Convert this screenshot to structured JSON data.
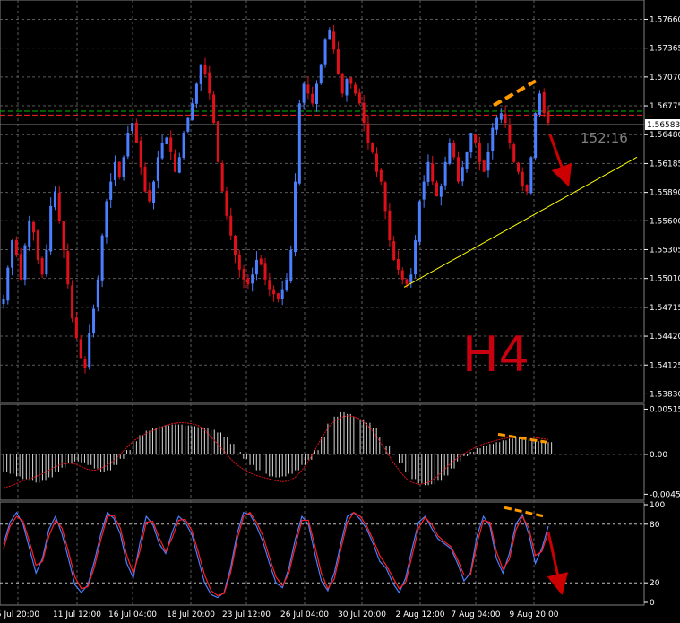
{
  "chart_data": [
    {
      "type": "candlestick",
      "panel": "main",
      "timeframe_label": "H4",
      "countdown": "152:16",
      "current_price": "1.56583",
      "y_ticks": [
        "1.57660",
        "1.57365",
        "1.57070",
        "1.56775",
        "1.56480",
        "1.56185",
        "1.55890",
        "1.55600",
        "1.55305",
        "1.55010",
        "1.54715",
        "1.54420",
        "1.54125",
        "1.53830"
      ],
      "ylim": [
        1.5377,
        1.5782
      ],
      "price_lines": [
        {
          "value": 1.5672,
          "color": "#00c000",
          "style": "dashed"
        },
        {
          "value": 1.5668,
          "color": "#ff2020",
          "style": "dashed"
        },
        {
          "value": 1.56583,
          "color": "#808080",
          "style": "solid"
        }
      ],
      "trendline": {
        "from": [
          "2 Aug 12:00",
          1.5492
        ],
        "to": [
          "9 Aug 20:00+",
          1.5644
        ],
        "color": "#ffff00"
      },
      "annotations": [
        {
          "type": "dashed-line",
          "color": "#ff9900",
          "from": [
            "7 Aug 04:00+",
            1.5678
          ],
          "to": [
            "9 Aug 20:00",
            1.5703
          ]
        },
        {
          "type": "arrow",
          "color": "#cc0000",
          "from": [
            "9 Aug 20:00+",
            1.5648
          ],
          "to": [
            "9 Aug 20:00++",
            1.5605
          ]
        }
      ],
      "close_path": [
        1.548,
        1.5512,
        1.554,
        1.5525,
        1.55,
        1.5535,
        1.556,
        1.5548,
        1.552,
        1.5505,
        1.553,
        1.5575,
        1.559,
        1.556,
        1.553,
        1.5495,
        1.546,
        1.544,
        1.542,
        1.541,
        1.5445,
        1.547,
        1.55,
        1.5545,
        1.558,
        1.56,
        1.562,
        1.5605,
        1.5625,
        1.565,
        1.566,
        1.564,
        1.5615,
        1.559,
        1.558,
        1.56,
        1.5625,
        1.564,
        1.5645,
        1.563,
        1.561,
        1.5625,
        1.565,
        1.5665,
        1.568,
        1.57,
        1.572,
        1.571,
        1.569,
        1.566,
        1.562,
        1.559,
        1.5565,
        1.5545,
        1.5525,
        1.551,
        1.55,
        1.5495,
        1.5505,
        1.552,
        1.5515,
        1.55,
        1.549,
        1.5485,
        1.548,
        1.549,
        1.55,
        1.553,
        1.56,
        1.568,
        1.57,
        1.569,
        1.568,
        1.57,
        1.572,
        1.5745,
        1.5755,
        1.5735,
        1.571,
        1.569,
        1.5705,
        1.57,
        1.569,
        1.568,
        1.566,
        1.564,
        1.563,
        1.561,
        1.56,
        1.557,
        1.554,
        1.552,
        1.551,
        1.55,
        1.5495,
        1.5505,
        1.554,
        1.558,
        1.56,
        1.562,
        1.56,
        1.5585,
        1.5595,
        1.562,
        1.564,
        1.5625,
        1.56,
        1.5615,
        1.563,
        1.565,
        1.564,
        1.562,
        1.561,
        1.563,
        1.5655,
        1.5665,
        1.567,
        1.566,
        1.564,
        1.562,
        1.561,
        1.5595,
        1.559,
        1.5625,
        1.567,
        1.569,
        1.567,
        1.566
      ]
    },
    {
      "type": "histogram",
      "panel": "oscillator",
      "y_ticks": [
        "0.00515",
        "0.00",
        "-0.00453"
      ],
      "ylim": [
        -0.0049,
        0.0054
      ],
      "annotations": [
        {
          "type": "dashed-line",
          "color": "#ff9900",
          "from": [
            "7 Aug 04:00+",
            0.0023
          ],
          "to": [
            "9 Aug 20:00",
            0.0014
          ]
        }
      ],
      "histogram_path": [
        -0.002,
        -0.0022,
        -0.0025,
        -0.0028,
        -0.003,
        -0.0032,
        -0.003,
        -0.0026,
        -0.002,
        -0.0015,
        -0.001,
        -0.0008,
        -0.0009,
        -0.0012,
        -0.0016,
        -0.002,
        -0.0018,
        -0.0012,
        -0.0005,
        0.0005,
        0.0015,
        0.0022,
        0.0027,
        0.003,
        0.0032,
        0.0033,
        0.0034,
        0.0034,
        0.0033,
        0.0032,
        0.0031,
        0.003,
        0.0028,
        0.0025,
        0.002,
        0.0012,
        0.0003,
        -0.0005,
        -0.0012,
        -0.0018,
        -0.0022,
        -0.0025,
        -0.0026,
        -0.0025,
        -0.0022,
        -0.0018,
        -0.0012,
        -0.0006,
        0.0005,
        0.002,
        0.0035,
        0.0043,
        0.0048,
        0.0046,
        0.0043,
        0.004,
        0.0036,
        0.003,
        0.002,
        0.001,
        0.0,
        -0.001,
        -0.002,
        -0.0028,
        -0.0033,
        -0.0035,
        -0.0034,
        -0.003,
        -0.0024,
        -0.0016,
        -0.0008,
        -0.0002,
        0.0003,
        0.0007,
        0.001,
        0.0012,
        0.0014,
        0.0016,
        0.0018,
        0.002,
        0.0019,
        0.0017,
        0.0015,
        0.0014,
        0.0014
      ],
      "signal_path": [
        -0.0038,
        -0.0036,
        -0.0033,
        -0.003,
        -0.0028,
        -0.0025,
        -0.0022,
        -0.0018,
        -0.0014,
        -0.0011,
        -0.001,
        -0.0011,
        -0.0014,
        -0.0017,
        -0.0018,
        -0.0016,
        -0.0012,
        -0.0007,
        0.0,
        0.0008,
        0.0015,
        0.002,
        0.0024,
        0.0027,
        0.003,
        0.0033,
        0.0035,
        0.0036,
        0.0036,
        0.0035,
        0.0033,
        0.0028,
        0.002,
        0.0012,
        0.0004,
        -0.0005,
        -0.0012,
        -0.0017,
        -0.0021,
        -0.0024,
        -0.0026,
        -0.0028,
        -0.003,
        -0.0031,
        -0.003,
        -0.0026,
        -0.0018,
        -0.0008,
        0.0005,
        0.0018,
        0.003,
        0.0038,
        0.0042,
        0.0044,
        0.0043,
        0.004,
        0.0034,
        0.0026,
        0.0015,
        0.0004,
        -0.0008,
        -0.0018,
        -0.0027,
        -0.0032,
        -0.0034,
        -0.0033,
        -0.003,
        -0.0024,
        -0.0017,
        -0.001,
        -0.0004,
        0.0001,
        0.0005,
        0.0009,
        0.0012,
        0.0014,
        0.0016,
        0.0018,
        0.0019,
        0.002,
        0.002,
        0.002,
        0.0019,
        0.0018,
        0.0017
      ]
    },
    {
      "type": "line",
      "panel": "stochastic",
      "y_ticks": [
        "100",
        "80",
        "20",
        "0"
      ],
      "ylim": [
        0,
        100
      ],
      "levels": [
        80,
        20
      ],
      "annotations": [
        {
          "type": "dashed-line",
          "color": "#ff9900",
          "from": [
            "7 Aug 04:00+",
            97
          ],
          "to": [
            "9 Aug 20:00",
            88
          ]
        },
        {
          "type": "arrow",
          "color": "#cc0000",
          "from": [
            "9 Aug 20:00+",
            72
          ],
          "to": [
            "9 Aug 20:00++",
            18
          ]
        }
      ],
      "series": [
        {
          "color": "#4a7fff",
          "values": [
            60,
            82,
            92,
            80,
            55,
            30,
            45,
            75,
            88,
            70,
            45,
            18,
            10,
            18,
            42,
            70,
            92,
            86,
            70,
            40,
            25,
            60,
            88,
            80,
            60,
            50,
            72,
            88,
            82,
            70,
            45,
            20,
            8,
            5,
            10,
            35,
            70,
            92,
            90,
            78,
            62,
            40,
            20,
            15,
            35,
            65,
            88,
            80,
            50,
            22,
            12,
            30,
            60,
            88,
            92,
            85,
            75,
            60,
            42,
            35,
            20,
            10,
            25,
            55,
            82,
            88,
            76,
            65,
            60,
            55,
            40,
            22,
            30,
            68,
            88,
            78,
            45,
            30,
            50,
            80,
            90,
            70,
            40,
            55,
            78
          ]
        },
        {
          "color": "#ff2020",
          "values": [
            55,
            78,
            88,
            83,
            62,
            38,
            42,
            68,
            84,
            76,
            52,
            26,
            14,
            16,
            36,
            64,
            88,
            89,
            76,
            48,
            30,
            52,
            82,
            83,
            66,
            52,
            66,
            84,
            85,
            74,
            52,
            28,
            12,
            7,
            9,
            30,
            64,
            88,
            92,
            82,
            68,
            46,
            26,
            17,
            30,
            58,
            84,
            84,
            58,
            30,
            14,
            24,
            54,
            82,
            92,
            88,
            78,
            64,
            48,
            38,
            26,
            14,
            20,
            48,
            76,
            87,
            80,
            68,
            62,
            57,
            44,
            28,
            28,
            60,
            84,
            82,
            52,
            34,
            44,
            74,
            88,
            76,
            48,
            52,
            72
          ]
        }
      ]
    },
    {
      "type": "axis",
      "x_ticks": [
        "5 Jul 20:00",
        "11 Jul 12:00",
        "16 Jul 04:00",
        "18 Jul 20:00",
        "23 Jul 12:00",
        "26 Jul 04:00",
        "30 Jul 20:00",
        "2 Aug 12:00",
        "7 Aug 04:00",
        "9 Aug 20:00"
      ]
    }
  ]
}
